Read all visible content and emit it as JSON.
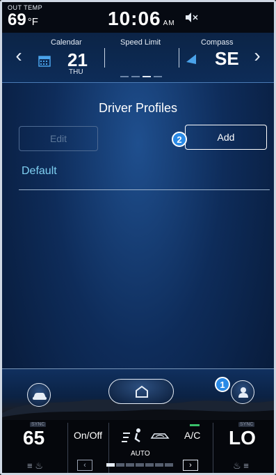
{
  "status": {
    "out_temp_label": "OUT TEMP",
    "out_temp_value": "69",
    "out_temp_unit": "°F",
    "time": "10:06",
    "ampm": "AM"
  },
  "info_panel": {
    "calendar_label": "Calendar",
    "calendar_day": "21",
    "calendar_dow": "THU",
    "speed_limit_label": "Speed Limit",
    "compass_label": "Compass",
    "compass_direction": "SE",
    "page_count": 4,
    "active_page": 3
  },
  "main": {
    "title": "Driver Profiles",
    "edit_label": "Edit",
    "add_label": "Add",
    "add_badge": "2",
    "profiles": [
      "Default"
    ]
  },
  "nav": {
    "profile_badge": "1"
  },
  "climate": {
    "sync_label": "SYNC",
    "driver_temp": "65",
    "passenger_temp": "LO",
    "onoff_label": "On/Off",
    "auto_label": "AUTO",
    "ac_label": "A/C",
    "fan_level_of_7": 1
  },
  "colors": {
    "accent_blue": "#2a8ae6",
    "profile_text": "#7fd0f2",
    "ac_led": "#39c06a"
  }
}
